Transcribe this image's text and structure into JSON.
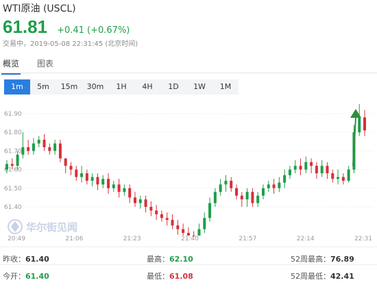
{
  "header": {
    "title": "WTI原油 (USCL)",
    "price": "61.81",
    "change": "+0.41 (+0.67%)",
    "status": "交易中，2019-05-08 22:31:45 (北京时间)"
  },
  "tabs": [
    {
      "label": "概览",
      "active": true
    },
    {
      "label": "图表",
      "active": false
    }
  ],
  "periods": [
    "1m",
    "5m",
    "15m",
    "30m",
    "1H",
    "4H",
    "1D",
    "1W",
    "1M"
  ],
  "active_period": "1m",
  "watermark": "华尔街见闻",
  "colors": {
    "up": "#1e9e4a",
    "down": "#d8303a",
    "accent": "#2a7ee0"
  },
  "chart_data": {
    "type": "candlestick",
    "y_ticks": [
      "61.90",
      "61.80",
      "61.70",
      "61.60",
      "61.50",
      "61.40"
    ],
    "x_ticks": [
      "20:49",
      "21:06",
      "21:23",
      "21:40",
      "21:57",
      "22:14",
      "22:31"
    ],
    "ylim": [
      61.08,
      62.1
    ],
    "annotation": "green-up-arrow",
    "series": {
      "open": [
        61.6,
        61.63,
        61.62,
        61.68,
        61.72,
        61.7,
        61.74,
        61.76,
        61.72,
        61.7,
        61.74,
        61.66,
        61.62,
        61.6,
        61.56,
        61.58,
        61.54,
        61.56,
        61.52,
        61.55,
        61.5,
        61.52,
        61.48,
        61.5,
        61.45,
        61.42,
        61.44,
        61.4,
        61.38,
        61.36,
        61.34,
        61.33,
        61.3,
        61.28,
        61.26,
        61.24,
        61.22,
        61.28,
        61.34,
        61.42,
        61.48,
        61.52,
        61.54,
        61.5,
        61.46,
        61.44,
        61.48,
        61.42,
        61.46,
        61.5,
        61.52,
        61.5,
        61.53,
        61.57,
        61.6,
        61.62,
        61.6,
        61.64,
        61.62,
        61.58,
        61.62,
        61.58,
        61.55,
        61.56,
        61.54,
        61.6,
        61.8,
        61.88
      ],
      "close": [
        61.63,
        61.62,
        61.68,
        61.72,
        61.7,
        61.74,
        61.76,
        61.72,
        61.7,
        61.74,
        61.66,
        61.62,
        61.6,
        61.56,
        61.58,
        61.54,
        61.56,
        61.52,
        61.55,
        61.5,
        61.52,
        61.48,
        61.5,
        61.45,
        61.42,
        61.44,
        61.4,
        61.38,
        61.36,
        61.34,
        61.33,
        61.3,
        61.28,
        61.26,
        61.24,
        61.22,
        61.28,
        61.34,
        61.42,
        61.48,
        61.52,
        61.54,
        61.5,
        61.46,
        61.44,
        61.48,
        61.42,
        61.46,
        61.5,
        61.52,
        61.5,
        61.53,
        61.57,
        61.6,
        61.62,
        61.6,
        61.64,
        61.62,
        61.58,
        61.62,
        61.58,
        61.55,
        61.56,
        61.54,
        61.6,
        61.8,
        61.88,
        61.81
      ],
      "high": [
        61.65,
        61.66,
        61.7,
        61.8,
        61.76,
        61.77,
        61.78,
        61.79,
        61.74,
        61.76,
        61.76,
        61.66,
        61.64,
        61.62,
        61.62,
        61.6,
        61.58,
        61.58,
        61.57,
        61.58,
        61.54,
        61.55,
        61.52,
        61.52,
        61.48,
        61.46,
        61.46,
        61.43,
        61.41,
        61.38,
        61.37,
        61.36,
        61.33,
        61.31,
        61.29,
        61.27,
        61.31,
        61.37,
        61.45,
        61.5,
        61.55,
        61.57,
        61.56,
        61.52,
        61.48,
        61.5,
        61.5,
        61.48,
        61.52,
        61.54,
        61.55,
        61.56,
        61.6,
        61.62,
        61.65,
        61.66,
        61.67,
        61.66,
        61.64,
        61.65,
        61.64,
        61.6,
        61.6,
        61.58,
        61.62,
        61.84,
        62.1,
        61.92
      ],
      "low": [
        61.58,
        61.6,
        61.6,
        61.66,
        61.68,
        61.68,
        61.72,
        61.7,
        61.68,
        61.68,
        61.64,
        61.58,
        61.57,
        61.54,
        61.53,
        61.52,
        61.51,
        61.49,
        61.5,
        61.47,
        61.48,
        61.45,
        61.46,
        61.42,
        61.4,
        61.39,
        61.37,
        61.35,
        61.33,
        61.32,
        61.3,
        61.28,
        61.25,
        61.22,
        61.2,
        61.08,
        61.2,
        61.26,
        61.32,
        61.4,
        61.46,
        61.48,
        61.48,
        61.44,
        61.4,
        61.4,
        61.4,
        61.4,
        61.44,
        61.48,
        61.47,
        61.48,
        61.5,
        61.55,
        61.58,
        61.57,
        61.58,
        61.58,
        61.55,
        61.56,
        61.55,
        61.53,
        61.52,
        61.52,
        61.53,
        61.58,
        61.78,
        61.78
      ]
    }
  },
  "stats": [
    {
      "label": "昨收：",
      "value": "61.40",
      "tone": "dark"
    },
    {
      "label": "最高：",
      "value": "62.10",
      "tone": "green"
    },
    {
      "label": "52周最高：",
      "value": "76.89",
      "tone": "dark"
    },
    {
      "label": "今开：",
      "value": "61.40",
      "tone": "green"
    },
    {
      "label": "最低：",
      "value": "61.08",
      "tone": "red"
    },
    {
      "label": "52周最低：",
      "value": "42.41",
      "tone": "dark"
    }
  ]
}
